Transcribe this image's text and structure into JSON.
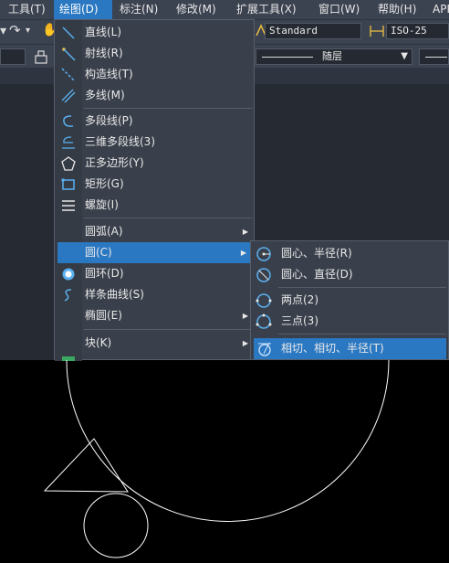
{
  "menubar": {
    "items": [
      {
        "label": "工具(T)",
        "active": false
      },
      {
        "label": "绘图(D)",
        "active": true
      },
      {
        "label": "标注(N)",
        "active": false
      },
      {
        "label": "修改(M)",
        "active": false
      },
      {
        "label": "扩展工具(X)",
        "active": false
      },
      {
        "label": "窗口(W)",
        "active": false
      },
      {
        "label": "帮助(H)",
        "active": false
      },
      {
        "label": "APP",
        "active": false
      }
    ]
  },
  "toolbar": {
    "text_style": "Standard",
    "dim_style": "ISO-25",
    "layer_linetype": "随层"
  },
  "draw_menu": {
    "items": [
      {
        "label": "直线(L)",
        "icon": "line-icon"
      },
      {
        "label": "射线(R)",
        "icon": "ray-icon"
      },
      {
        "label": "构造线(T)",
        "icon": "xline-icon"
      },
      {
        "label": "多线(M)",
        "icon": "mline-icon"
      },
      {
        "label": "多段线(P)",
        "icon": "polyline-icon"
      },
      {
        "label": "三维多段线(3)",
        "icon": "3dpoly-icon"
      },
      {
        "label": "正多边形(Y)",
        "icon": "polygon-icon"
      },
      {
        "label": "矩形(G)",
        "icon": "rectangle-icon"
      },
      {
        "label": "螺旋(I)",
        "icon": "helix-icon"
      },
      {
        "label": "圆弧(A)",
        "icon": ""
      },
      {
        "label": "圆(C)",
        "icon": ""
      },
      {
        "label": "圆环(D)",
        "icon": "donut-icon"
      },
      {
        "label": "样条曲线(S)",
        "icon": "spline-icon"
      },
      {
        "label": "椭圆(E)",
        "icon": ""
      },
      {
        "label": "块(K)",
        "icon": ""
      }
    ]
  },
  "circle_submenu": {
    "items": [
      {
        "label": "圆心、半径(R)",
        "icon": "circle-center-radius-icon"
      },
      {
        "label": "圆心、直径(D)",
        "icon": "circle-center-diameter-icon"
      },
      {
        "label": "两点(2)",
        "icon": "circle-2point-icon"
      },
      {
        "label": "三点(3)",
        "icon": "circle-3point-icon"
      },
      {
        "label": "相切、相切、半径(T)",
        "icon": "circle-ttr-icon"
      }
    ]
  },
  "colors": {
    "menubar_bg": "#3b4250",
    "highlight": "#2b78c2",
    "menu_bg": "#3a404b",
    "canvas_bg": "#000000",
    "drawing_stroke": "#ffffff"
  }
}
